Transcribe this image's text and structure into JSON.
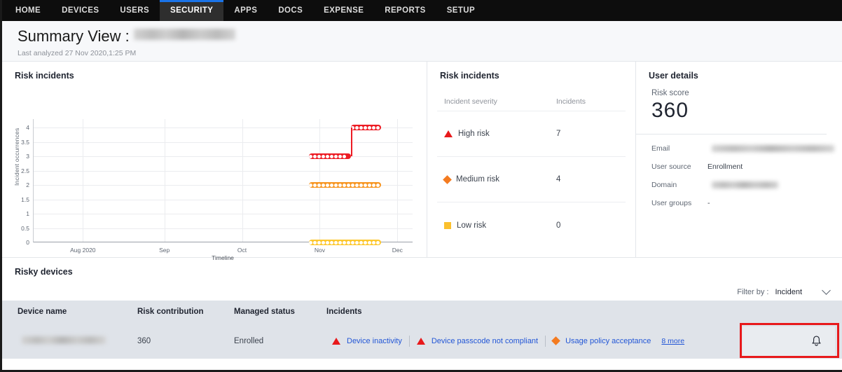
{
  "nav": {
    "items": [
      {
        "label": "HOME",
        "active": false
      },
      {
        "label": "DEVICES",
        "active": false
      },
      {
        "label": "USERS",
        "active": false
      },
      {
        "label": "SECURITY",
        "active": true
      },
      {
        "label": "APPS",
        "active": false
      },
      {
        "label": "DOCS",
        "active": false
      },
      {
        "label": "EXPENSE",
        "active": false
      },
      {
        "label": "REPORTS",
        "active": false
      },
      {
        "label": "SETUP",
        "active": false
      }
    ]
  },
  "header": {
    "title": "Summary View :",
    "subtitle": "Last analyzed 27 Nov 2020,1:25 PM"
  },
  "chart_panel": {
    "title": "Risk incidents"
  },
  "chart_data": {
    "type": "line",
    "title": "Risk incidents",
    "xlabel": "Timeline",
    "ylabel": "Incident occurrences",
    "xticks": [
      "Aug 2020",
      "Sep",
      "Oct",
      "Nov",
      "Dec"
    ],
    "yticks": [
      "0",
      "0.5",
      "1",
      "1.5",
      "2",
      "2.5",
      "3",
      "3.5",
      "4"
    ],
    "ylim": [
      0,
      4.3
    ],
    "grid": true,
    "legend": "none",
    "series": [
      {
        "name": "High risk",
        "color": "#ed1c24",
        "segments": [
          {
            "x_start_pct": 72.5,
            "x_end_pct": 83.5,
            "value": 3
          },
          {
            "x_start_pct": 83.5,
            "x_end_pct": 91.5,
            "value": 4
          }
        ]
      },
      {
        "name": "Medium risk",
        "color": "#f7941e",
        "segments": [
          {
            "x_start_pct": 72.5,
            "x_end_pct": 91.5,
            "value": 2
          }
        ]
      },
      {
        "name": "Low risk",
        "color": "#fdc82f",
        "segments": [
          {
            "x_start_pct": 72.5,
            "x_end_pct": 91.5,
            "value": 0
          }
        ]
      }
    ]
  },
  "incidents_panel": {
    "title": "Risk incidents",
    "columns": [
      "Incident severity",
      "Incidents"
    ],
    "rows": [
      {
        "severity": "High risk",
        "count": "7",
        "symbol": "triangle",
        "color": "#e8191b"
      },
      {
        "severity": "Medium risk",
        "count": "4",
        "symbol": "diamond",
        "color": "#f47b20"
      },
      {
        "severity": "Low risk",
        "count": "0",
        "symbol": "square",
        "color": "#fbc02d"
      }
    ]
  },
  "user_details": {
    "title": "User details",
    "risk_score_label": "Risk score",
    "risk_score": "360",
    "fields": [
      {
        "key": "Email",
        "value": "",
        "redacted": true
      },
      {
        "key": "User source",
        "value": "Enrollment",
        "redacted": false
      },
      {
        "key": "Domain",
        "value": "",
        "redacted": true
      },
      {
        "key": "User groups",
        "value": "-",
        "redacted": false
      }
    ]
  },
  "risky_devices": {
    "title": "Risky devices",
    "filter_label": "Filter by :",
    "filter_value": "Incident",
    "columns": [
      "Device name",
      "Risk contribution",
      "Managed status",
      "Incidents"
    ],
    "row": {
      "device_name": "",
      "risk_contribution": "360",
      "managed_status": "Enrolled",
      "incidents": [
        {
          "label": "Device inactivity",
          "symbol": "triangle",
          "color": "#e8191b"
        },
        {
          "label": "Device passcode not compliant",
          "symbol": "triangle",
          "color": "#e8191b"
        },
        {
          "label": "Usage policy acceptance",
          "symbol": "diamond",
          "color": "#f47b20"
        }
      ],
      "more_link": "8 more",
      "action_icon": "bell-icon"
    }
  }
}
